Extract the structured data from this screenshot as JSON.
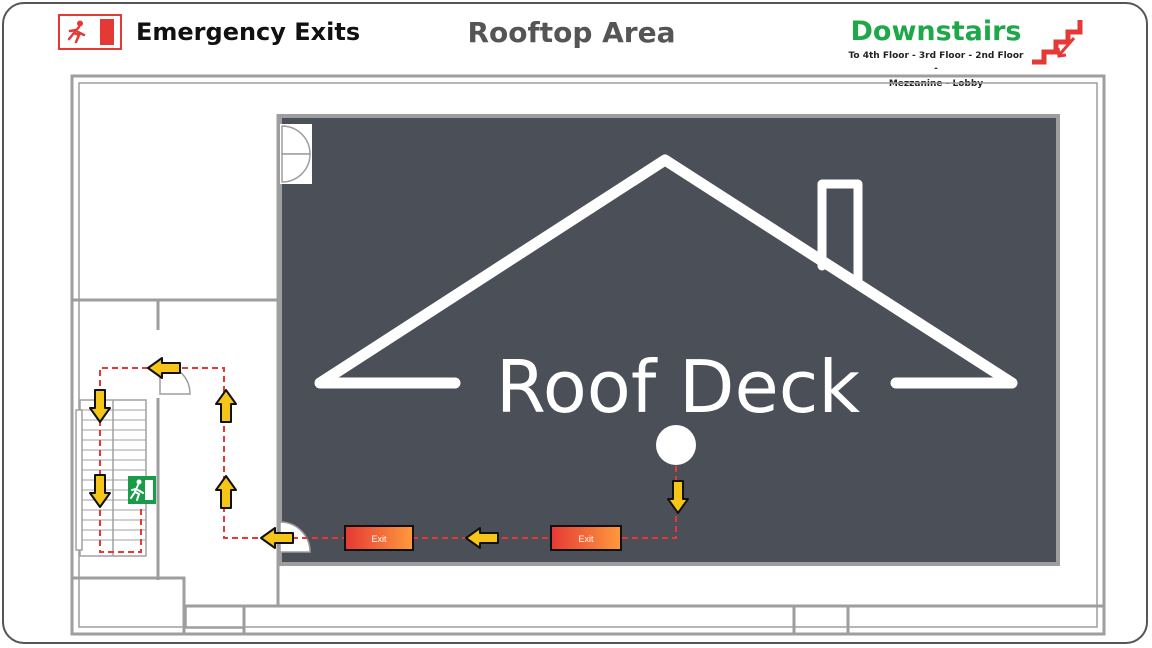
{
  "header": {
    "legend_title": "Emergency Exits",
    "page_title": "Rooftop Area",
    "downstairs_title": "Downstairs",
    "downstairs_line1": "To 4th Floor - 3rd Floor - 2nd Floor -",
    "downstairs_line2": "Mezzanine - Lobby"
  },
  "plan": {
    "deck_label": "Roof Deck",
    "exit_signs": [
      "Exit",
      "Exit"
    ]
  },
  "icons": [
    "exit-door-icon",
    "running-man-icon",
    "downstairs-icon",
    "emergency-exit-sign-icon",
    "direction-arrow-icon",
    "door-swing-icon",
    "house-outline-icon"
  ],
  "colors": {
    "deck": "#4b5058",
    "route": "#e53935",
    "arrow": "#f5c518",
    "downstairs": "#1ea84a",
    "exit_sign_green": "#1a9b4a"
  }
}
